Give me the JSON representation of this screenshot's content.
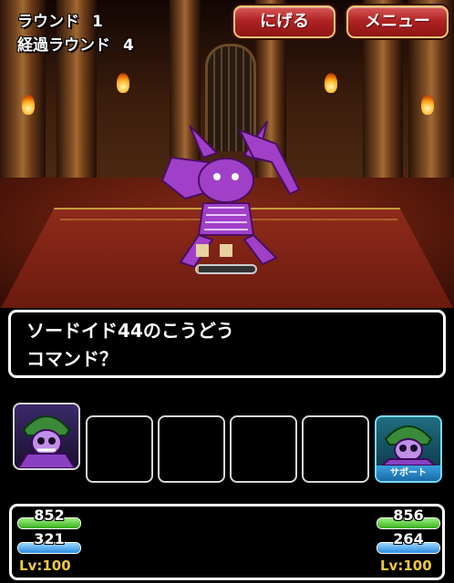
{
  "round": {
    "label": "ラウンド",
    "value": "1"
  },
  "elapsed": {
    "label": "経過ラウンド",
    "value": "4"
  },
  "buttons": {
    "flee": "にげる",
    "menu": "メニュー"
  },
  "enemy": {
    "icon": "skeleton-dragon-monster",
    "hp_fraction": 0.03
  },
  "message": {
    "line1": "ソードイド44のこうどう",
    "line2": "コマンド？"
  },
  "party": {
    "left": {
      "icon": "skeleton-hood-monster"
    },
    "right": {
      "icon": "skeleton-hood-monster",
      "support_label": "サポート"
    }
  },
  "status": {
    "left": {
      "hp": "852",
      "mp": "321",
      "level": "Lv:100",
      "hp_fraction": 1.0,
      "mp_fraction": 1.0
    },
    "right": {
      "hp": "856",
      "mp": "264",
      "level": "Lv:100",
      "hp_fraction": 1.0,
      "mp_fraction": 1.0
    }
  },
  "colors": {
    "button_red": "#b02424",
    "button_border": "#e8c878",
    "hp_green": "#38b020",
    "mp_blue": "#2a8ae0",
    "level_gold": "#f0c840",
    "support_blue": "#1a6aa8"
  }
}
